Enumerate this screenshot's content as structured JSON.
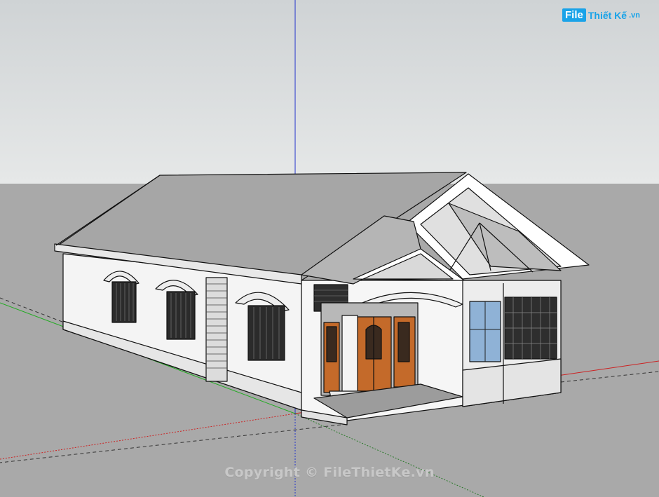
{
  "watermark": {
    "logo_box": "File",
    "logo_text": "Thiết Kế",
    "logo_suffix": ".vn",
    "copyright": "Copyright © FileThietKe.vn"
  },
  "colors": {
    "sky_top": "#cfd3d5",
    "sky_bottom": "#e6e8e8",
    "ground": "#a9a9a9",
    "roof": "#a6a6a6",
    "wall": "#f2f2f2",
    "door": "#c46a2a",
    "axis_blue": "#2233cc",
    "axis_red": "#cc2222",
    "axis_green": "#22aa22",
    "window_glass": "#8fb2d6",
    "brand": "#1aa3e8"
  },
  "icons": {
    "logo": "filethietke-logo"
  }
}
